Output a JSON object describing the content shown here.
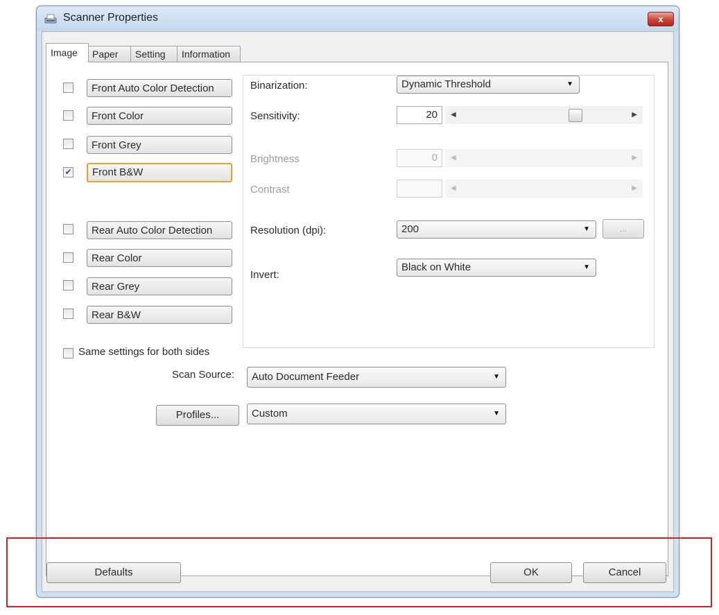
{
  "window": {
    "title": "Scanner Properties",
    "close_label": "x"
  },
  "tabs": [
    {
      "label": "Image",
      "active": true
    },
    {
      "label": "Paper",
      "active": false
    },
    {
      "label": "Setting",
      "active": false
    },
    {
      "label": "Information",
      "active": false
    }
  ],
  "image_types": [
    {
      "label": "Front Auto Color Detection",
      "checked": false
    },
    {
      "label": "Front Color",
      "checked": false
    },
    {
      "label": "Front Grey",
      "checked": false
    },
    {
      "label": "Front B&W",
      "checked": true,
      "focused": true
    },
    {
      "label": "Rear Auto Color Detection",
      "checked": false
    },
    {
      "label": "Rear Color",
      "checked": false
    },
    {
      "label": "Rear Grey",
      "checked": false
    },
    {
      "label": "Rear B&W",
      "checked": false
    }
  ],
  "settings": {
    "binarization": {
      "label": "Binarization:",
      "value": "Dynamic Threshold"
    },
    "sensitivity": {
      "label": "Sensitivity:",
      "value": "20",
      "level": 0.7
    },
    "brightness": {
      "label": "Brightness",
      "value": "0",
      "enabled": false
    },
    "contrast": {
      "label": "Contrast",
      "value": "",
      "enabled": false
    },
    "resolution": {
      "label": "Resolution (dpi):",
      "value": "200",
      "more_label": "..."
    },
    "invert": {
      "label": "Invert:",
      "value": "Black on White"
    }
  },
  "same_settings": {
    "label": "Same settings for both sides",
    "checked": false
  },
  "scan_source": {
    "label": "Scan Source:",
    "value": "Auto Document Feeder"
  },
  "profiles": {
    "button_label": "Profiles...",
    "value": "Custom"
  },
  "footer": {
    "defaults_label": "Defaults",
    "ok_label": "OK",
    "cancel_label": "Cancel"
  },
  "icons": {
    "checkmark": "✔",
    "dropdown": "▼",
    "arrow_left": "◀",
    "arrow_right": "▶"
  },
  "colors": {
    "focus_border": "#e8a22f",
    "highlight_box": "#c8262b"
  }
}
